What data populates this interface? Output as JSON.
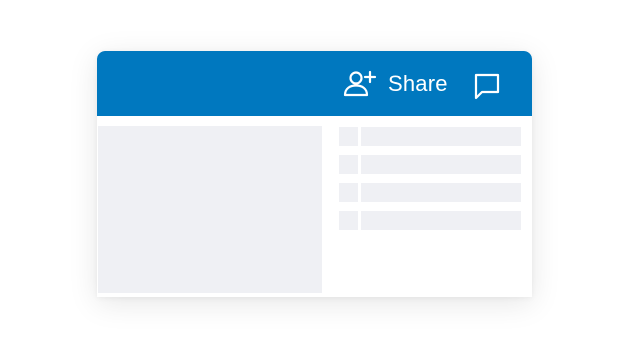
{
  "header": {
    "background_color": "#0078bf",
    "share_label": "Share",
    "share_icon": "add-user-icon",
    "chat_icon": "chat-icon"
  },
  "content": {
    "placeholder_color": "#eff0f4",
    "list_rows": 4
  }
}
